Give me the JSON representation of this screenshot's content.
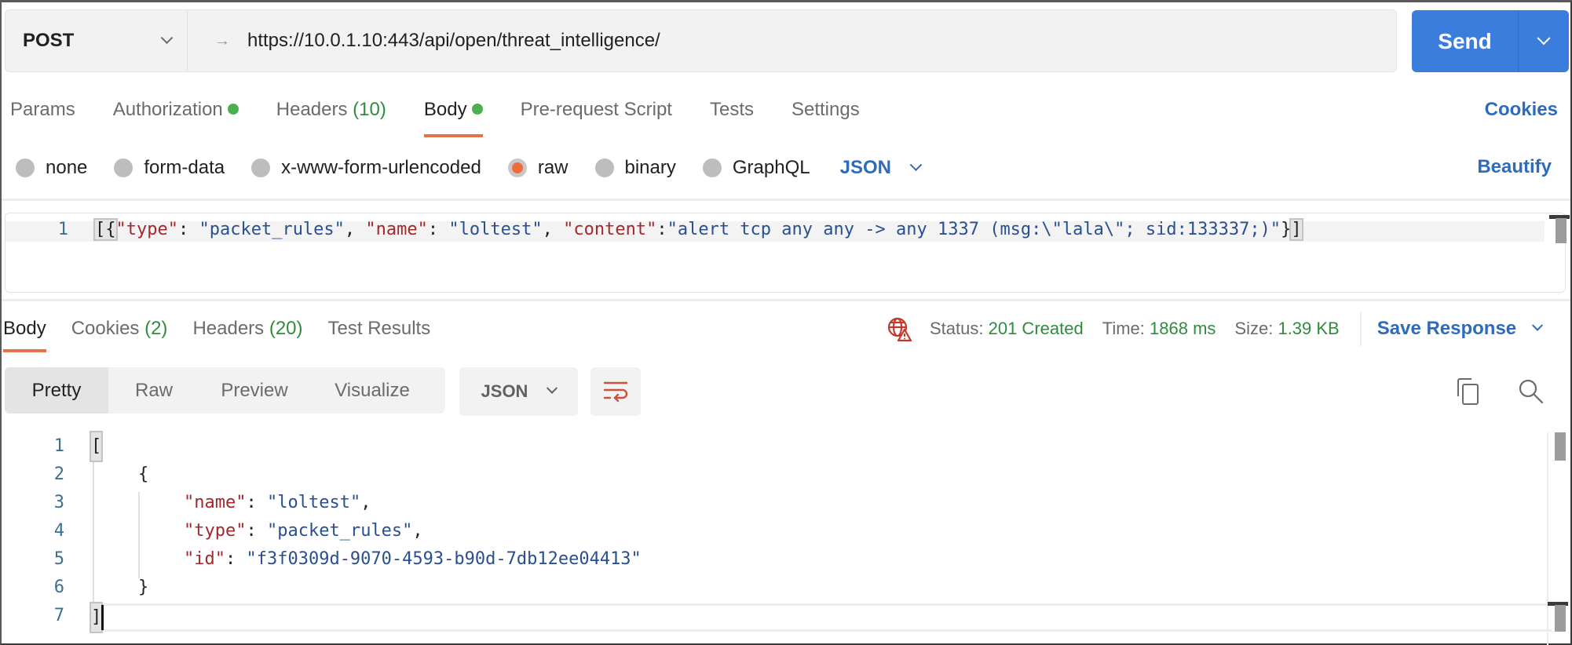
{
  "request": {
    "method": "POST",
    "url": "https://10.0.1.10:443/api/open/threat_intelligence/",
    "send_label": "Send",
    "tabs": [
      {
        "label": "Params",
        "active": false
      },
      {
        "label": "Authorization",
        "indicator": "green-dot",
        "active": false
      },
      {
        "label": "Headers",
        "count": "(10)",
        "active": false
      },
      {
        "label": "Body",
        "indicator": "green-dot",
        "active": true
      },
      {
        "label": "Pre-request Script",
        "active": false
      },
      {
        "label": "Tests",
        "active": false
      },
      {
        "label": "Settings",
        "active": false
      }
    ],
    "cookies_link": "Cookies",
    "body_types": [
      {
        "label": "none",
        "checked": false
      },
      {
        "label": "form-data",
        "checked": false
      },
      {
        "label": "x-www-form-urlencoded",
        "checked": false
      },
      {
        "label": "raw",
        "checked": true
      },
      {
        "label": "binary",
        "checked": false
      },
      {
        "label": "GraphQL",
        "checked": false
      }
    ],
    "raw_language": "JSON",
    "beautify_link": "Beautify",
    "body_editor": {
      "line_number": "1",
      "tokens": {
        "open": "[{",
        "k1": "\"type\"",
        "c1": ": ",
        "v1": "\"packet_rules\"",
        "sep1": ", ",
        "k2": "\"name\"",
        "c2": ": ",
        "v2": "\"loltest\"",
        "sep2": ", ",
        "k3": "\"content\"",
        "c3": ":",
        "v3": "\"alert tcp any any -> any 1337 (msg:\\\"lala\\\"; sid:133337;)\"",
        "close_brace": "}",
        "close_bracket": "]"
      }
    }
  },
  "response": {
    "tabs": [
      {
        "label": "Body",
        "active": true
      },
      {
        "label": "Cookies",
        "count": "(2)",
        "active": false
      },
      {
        "label": "Headers",
        "count": "(20)",
        "active": false
      },
      {
        "label": "Test Results",
        "active": false
      }
    ],
    "status_label": "Status:",
    "status_value": "201 Created",
    "time_label": "Time:",
    "time_value": "1868 ms",
    "size_label": "Size:",
    "size_value": "1.39 KB",
    "save_response": "Save Response",
    "view_modes": [
      "Pretty",
      "Raw",
      "Preview",
      "Visualize"
    ],
    "active_view": "Pretty",
    "format": "JSON",
    "icons": {
      "status": "globe-warning-icon",
      "wrap": "word-wrap-icon",
      "copy": "copy-icon",
      "search": "search-icon"
    },
    "body_lines": [
      {
        "n": "1",
        "text": "["
      },
      {
        "n": "2",
        "text": "{"
      },
      {
        "n": "3",
        "key": "\"name\"",
        "value": "\"loltest\"",
        "trail": ","
      },
      {
        "n": "4",
        "key": "\"type\"",
        "value": "\"packet_rules\"",
        "trail": ","
      },
      {
        "n": "5",
        "key": "\"id\"",
        "value": "\"f3f0309d-9070-4593-b90d-7db12ee04413\"",
        "trail": ""
      },
      {
        "n": "6",
        "text": "}"
      },
      {
        "n": "7",
        "text": "]"
      }
    ]
  },
  "colors": {
    "accent_orange": "#e27349",
    "send_blue": "#3b7ddd",
    "link_blue": "#2e6bbd",
    "success_green": "#2f8c3f",
    "json_key": "#a1282c",
    "json_string": "#2a4f8f"
  }
}
